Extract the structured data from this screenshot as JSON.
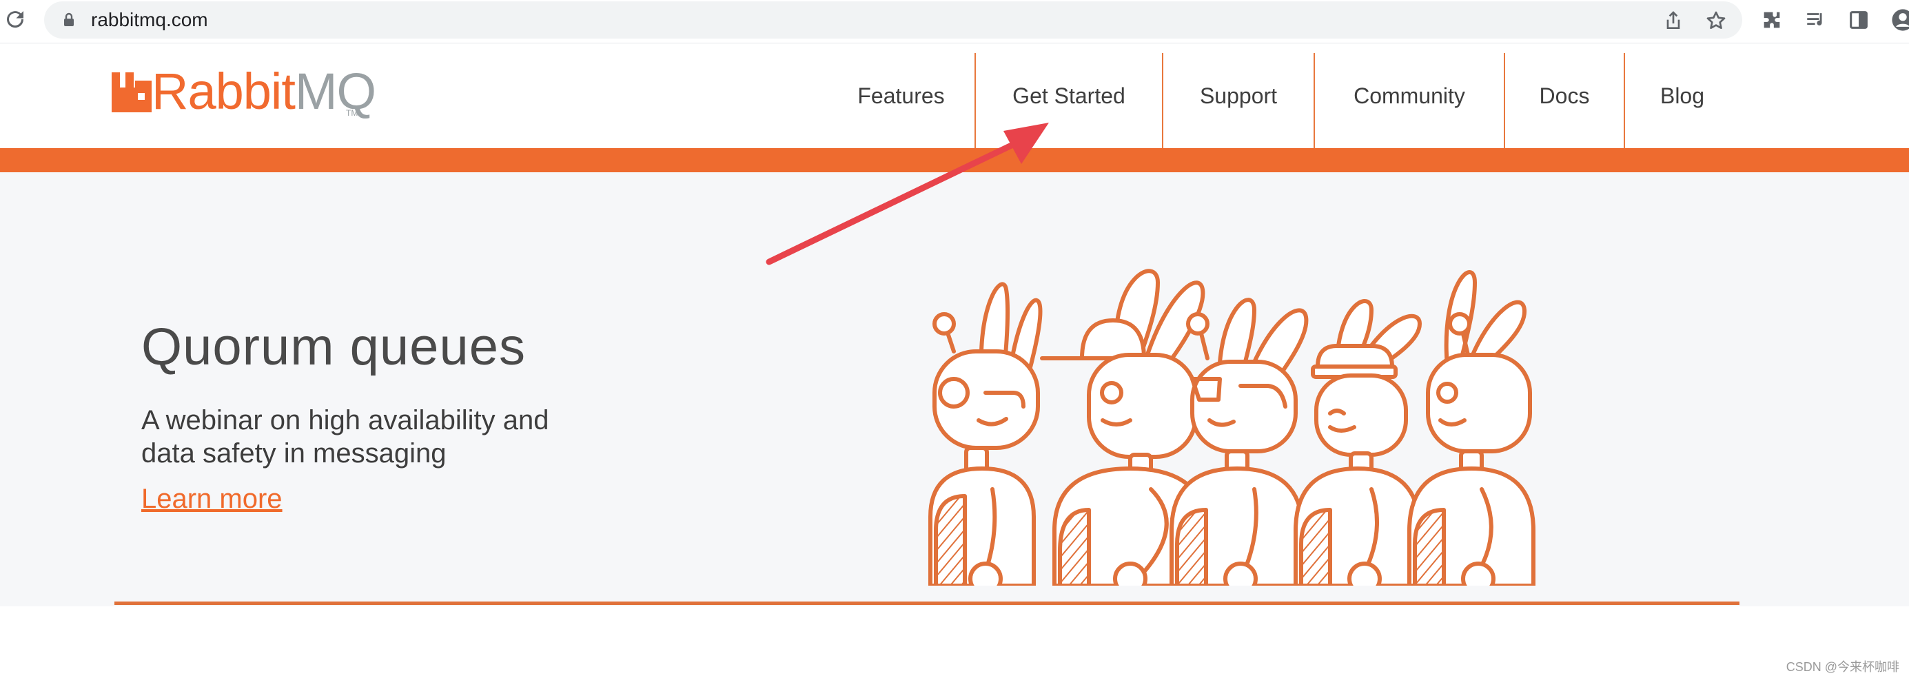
{
  "browser": {
    "url": "rabbitmq.com",
    "icons": [
      "reload-icon",
      "lock-icon",
      "share-icon",
      "bookmark-star-icon",
      "extensions-icon",
      "media-queue-icon",
      "side-panel-icon",
      "profile-avatar-icon"
    ]
  },
  "site": {
    "logo": {
      "rabbit": "Rabbit",
      "mq": "MQ",
      "tm": "TM"
    },
    "nav": [
      {
        "label": "Features"
      },
      {
        "label": "Get Started"
      },
      {
        "label": "Support"
      },
      {
        "label": "Community"
      },
      {
        "label": "Docs"
      },
      {
        "label": "Blog"
      }
    ],
    "colors": {
      "brand": "#ee6b2f",
      "annotation_arrow": "#e8434b"
    }
  },
  "hero": {
    "title": "Quorum queues",
    "subtitle": "A webinar on high availability and data safety in messaging",
    "cta": "Learn more"
  },
  "watermark": "CSDN @今来杯咖啡"
}
